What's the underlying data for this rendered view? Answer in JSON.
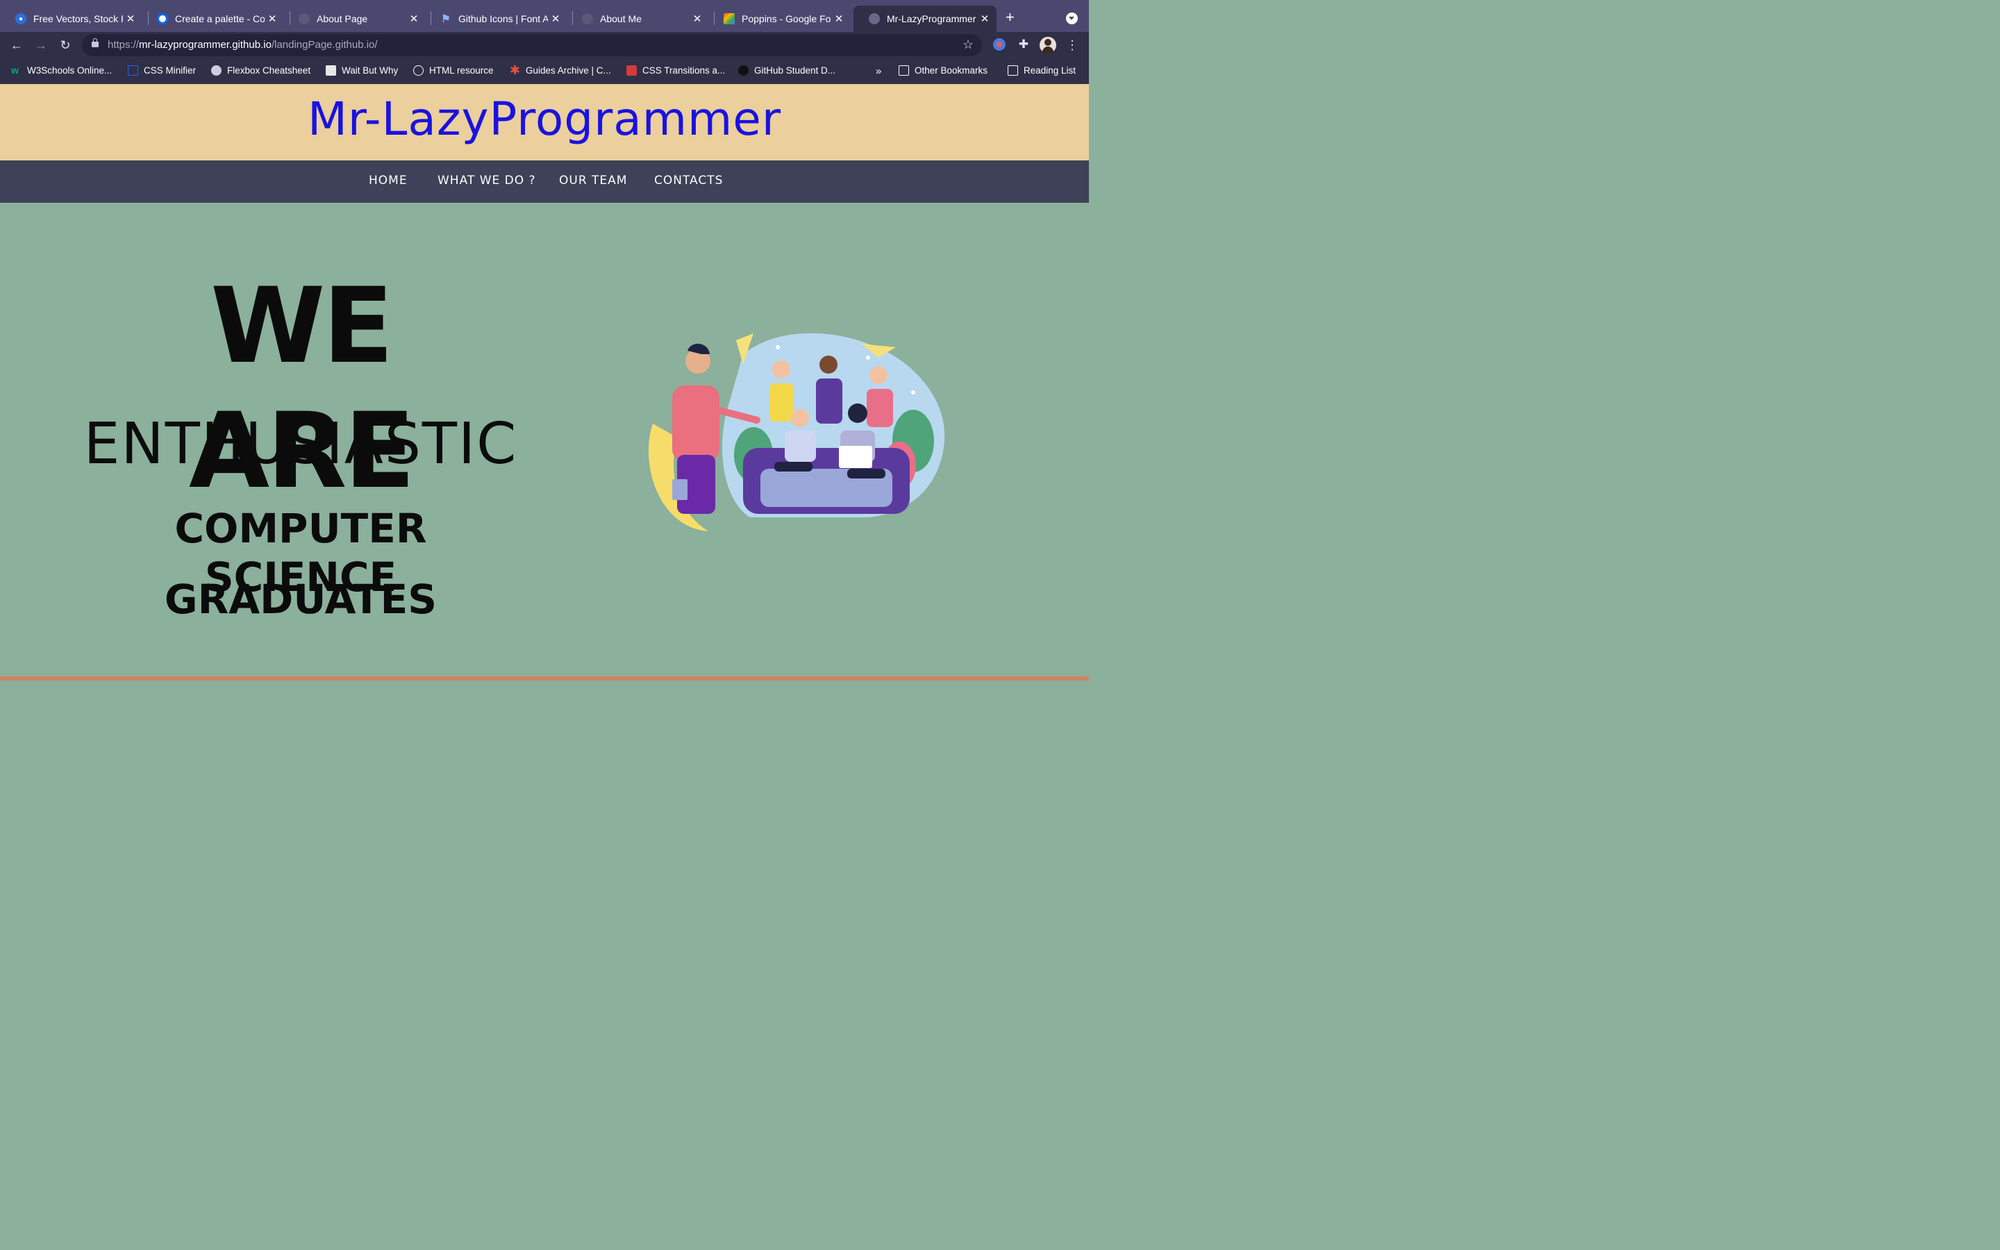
{
  "browser": {
    "tabs": [
      {
        "title": "Free Vectors, Stock P",
        "icon": "freepik-icon",
        "active": false
      },
      {
        "title": "Create a palette - Coo",
        "icon": "coolors-icon",
        "active": false
      },
      {
        "title": "About Page",
        "icon": "globe-icon",
        "active": false
      },
      {
        "title": "Github Icons | Font Aw",
        "icon": "flag-icon",
        "active": false
      },
      {
        "title": "About Me",
        "icon": "globe-icon",
        "active": false
      },
      {
        "title": "Poppins - Google Fon",
        "icon": "google-fonts-icon",
        "active": false
      },
      {
        "title": "Mr-LazyProgrammer",
        "icon": "globe-icon",
        "active": true
      }
    ],
    "close_glyph": "✕",
    "new_tab_glyph": "+",
    "url_scheme": "https://",
    "url_host": "mr-lazyprogrammer.github.io",
    "url_path": "/landingPage.github.io/",
    "bookmarks": [
      {
        "label": "W3Schools Online...",
        "icon": "w3schools-icon",
        "color": "#04aa6d"
      },
      {
        "label": "CSS Minifier",
        "icon": "css-icon",
        "color": "#2965f1"
      },
      {
        "label": "Flexbox Cheatsheet",
        "icon": "avatar-icon",
        "color": "#ccccdd"
      },
      {
        "label": "Wait But Why",
        "icon": "waitbutwhy-icon",
        "color": "#e6e6e6"
      },
      {
        "label": "HTML resource",
        "icon": "angular-icon",
        "color": "#222222"
      },
      {
        "label": "Guides Archive | C...",
        "icon": "asterisk-icon",
        "color": "#e8503a"
      },
      {
        "label": "CSS Transitions a...",
        "icon": "robot-icon",
        "color": "#d43a3a"
      },
      {
        "label": "GitHub Student D...",
        "icon": "github-icon",
        "color": "#111111"
      }
    ],
    "overflow_glyph": "»",
    "other_bookmarks": "Other Bookmarks",
    "reading_list": "Reading List"
  },
  "site": {
    "title": "Mr-LazyProgrammer",
    "nav": [
      "HOME",
      "WHAT WE DO ?",
      "OUR TEAM",
      "CONTACTS"
    ],
    "hero": {
      "line1": "WE ARE",
      "line2": "ENTHUSIASTIC",
      "line3": "COMPUTER SCIENCE",
      "line4": "GRADUATES"
    },
    "colors": {
      "header_bg": "#ebcf9c",
      "title_color": "#1a12e0",
      "nav_bg": "#3e4157",
      "hero_bg": "#8bb09c",
      "accent_bar": "#d0825e"
    }
  }
}
